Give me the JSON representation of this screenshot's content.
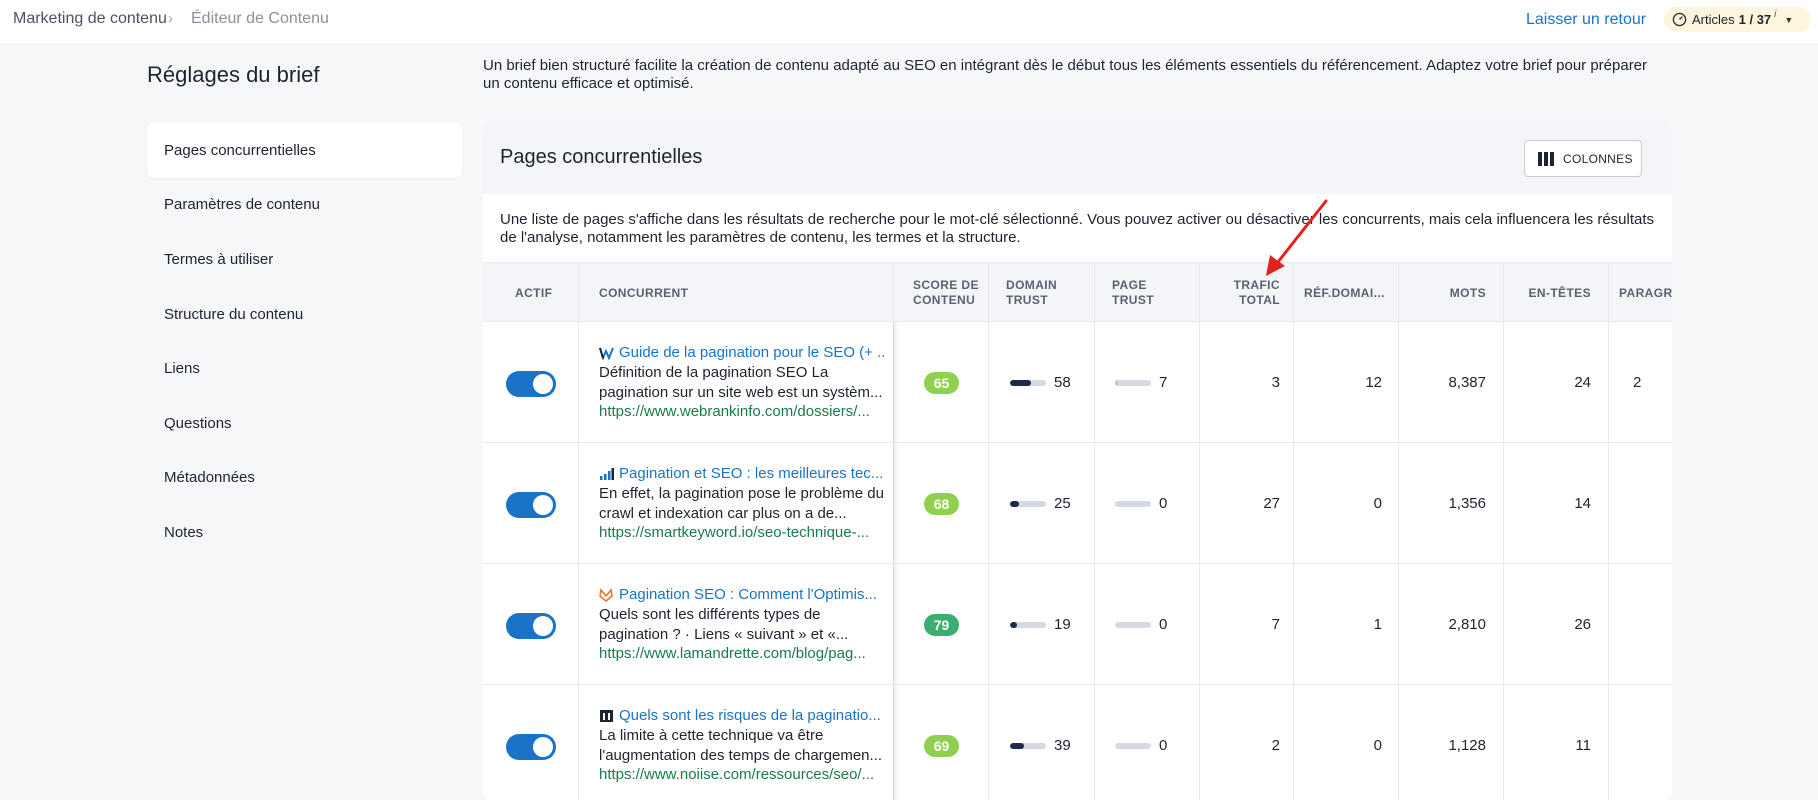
{
  "breadcrumb": {
    "parent": "Marketing de contenu",
    "separator": "›",
    "current": "Éditeur de Contenu"
  },
  "header": {
    "feedback": "Laisser un retour",
    "articles_label": "Articles",
    "articles_count": "1 / 37",
    "info": "i"
  },
  "sidebar": {
    "title": "Réglages du brief",
    "items": [
      {
        "label": "Pages concurrentielles",
        "active": true
      },
      {
        "label": "Paramètres de contenu"
      },
      {
        "label": "Termes à utiliser"
      },
      {
        "label": "Structure du contenu"
      },
      {
        "label": "Liens"
      },
      {
        "label": "Questions"
      },
      {
        "label": "Métadonnées"
      },
      {
        "label": "Notes"
      }
    ]
  },
  "intro": "Un brief bien structuré facilite la création de contenu adapté au SEO en intégrant dès le début tous les éléments essentiels du référencement. Adaptez votre brief pour préparer un contenu efficace et optimisé.",
  "panel": {
    "title": "Pages concurrentielles",
    "columns_button": "COLONNES",
    "description": "Une liste de pages s'affiche dans les résultats de recherche pour le mot-clé sélectionné. Vous pouvez activer ou désactiver les concurrents, mais cela influencera les résultats de l'analyse, notamment les paramètres de contenu, les termes et la structure."
  },
  "table": {
    "headers": {
      "actif": "ACTIF",
      "concurrent": "CONCURRENT",
      "score": "SCORE DE CONTENU",
      "domain_trust": "DOMAIN TRUST",
      "page_trust": "PAGE TRUST",
      "trafic": "TRAFIC TOTAL",
      "ref": "RÉF.DOMAI...",
      "mots": "MOTS",
      "entetes": "EN-TÊTES",
      "paragr": "PARAGR..."
    },
    "rows": [
      {
        "active": true,
        "favicon": "webrankinfo-icon",
        "title": "Guide de la pagination pour le SEO (+ ...",
        "snippet": "Définition de la pagination SEO La pagination sur un site web est un systèm...",
        "url": "https://www.webrankinfo.com/dossiers/...",
        "score": "65",
        "score_color": "#8fd14f",
        "domain_trust": "58",
        "domain_trust_level": 0.58,
        "page_trust": "7",
        "page_trust_level": 0.07,
        "trafic": "3",
        "ref": "12",
        "mots": "8,387",
        "entetes": "24",
        "paragr": "2"
      },
      {
        "active": true,
        "favicon": "smartkeyword-icon",
        "title": "Pagination et SEO : les meilleures tec...",
        "snippet": "En effet, la pagination pose le problème du crawl et indexation car plus on a de...",
        "url": "https://smartkeyword.io/seo-technique-...",
        "score": "68",
        "score_color": "#8fd14f",
        "domain_trust": "25",
        "domain_trust_level": 0.25,
        "page_trust": "0",
        "page_trust_level": 0,
        "trafic": "27",
        "ref": "0",
        "mots": "1,356",
        "entetes": "14",
        "paragr": ""
      },
      {
        "active": true,
        "favicon": "lamandrette-icon",
        "title": "Pagination SEO : Comment l'Optimis...",
        "snippet": "Quels sont les différents types de pagination ? · Liens « suivant » et «...",
        "url": "https://www.lamandrette.com/blog/pag...",
        "score": "79",
        "score_color": "#3aae6e",
        "domain_trust": "19",
        "domain_trust_level": 0.19,
        "page_trust": "0",
        "page_trust_level": 0,
        "trafic": "7",
        "ref": "1",
        "mots": "2,810",
        "entetes": "26",
        "paragr": ""
      },
      {
        "active": true,
        "favicon": "noiise-icon",
        "title": "Quels sont les risques de la paginatio...",
        "snippet": "La limite à cette technique va être l'augmentation des temps de chargemen...",
        "url": "https://www.noiise.com/ressources/seo/...",
        "score": "69",
        "score_color": "#8fd14f",
        "domain_trust": "39",
        "domain_trust_level": 0.39,
        "page_trust": "0",
        "page_trust_level": 0,
        "trafic": "2",
        "ref": "0",
        "mots": "1,128",
        "entetes": "11",
        "paragr": ""
      }
    ]
  },
  "colors": {
    "accent": "#1a73c7",
    "url": "#1b7a4a",
    "bar_dark": "#1e2a4a",
    "bar_page": "#c9b8e8",
    "annotation": "#e0231c"
  }
}
